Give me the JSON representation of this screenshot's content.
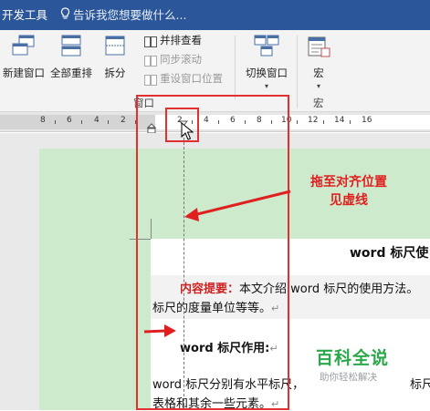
{
  "titlebar": {
    "tab_developer": "开发工具",
    "tell_me": "告诉我您想要做什么..."
  },
  "ribbon": {
    "new_window": "新建窗口",
    "arrange_all": "全部重排",
    "split": "拆分",
    "view_side_by_side": "并排查看",
    "sync_scroll": "同步滚动",
    "reset_window_position": "重设窗口位置",
    "switch_windows": "切换窗口",
    "macros": "宏",
    "group_window": "窗口",
    "group_macros": "宏"
  },
  "ruler": {
    "labels": [
      "8",
      "6",
      "4",
      "2",
      "2",
      "4",
      "6",
      "8",
      "10",
      "12",
      "14",
      "16"
    ]
  },
  "annotation": {
    "line1": "拖至对齐位置",
    "line2": "见虚线"
  },
  "document": {
    "heading": "word 标尺使",
    "summary_label": "内容提要：",
    "summary_text": "本文介绍 word 标尺的使用方法。",
    "summary_line2": "标尺的度量单位等等。",
    "section_title": "word 标尺作用:",
    "body_line1": "word 标尺分别有水平标尺，",
    "body_line1_tail": "标尺",
    "body_line2": "表格和其余一些元素。",
    "return_mark": "↵"
  },
  "watermark": {
    "title": "百科全说",
    "subtitle": "助你轻松解决"
  },
  "colors": {
    "title_bar": "#2b579a",
    "annotation_red": "#e02020",
    "page_green": "#cdeacd",
    "watermark_green": "#2aa84a"
  }
}
